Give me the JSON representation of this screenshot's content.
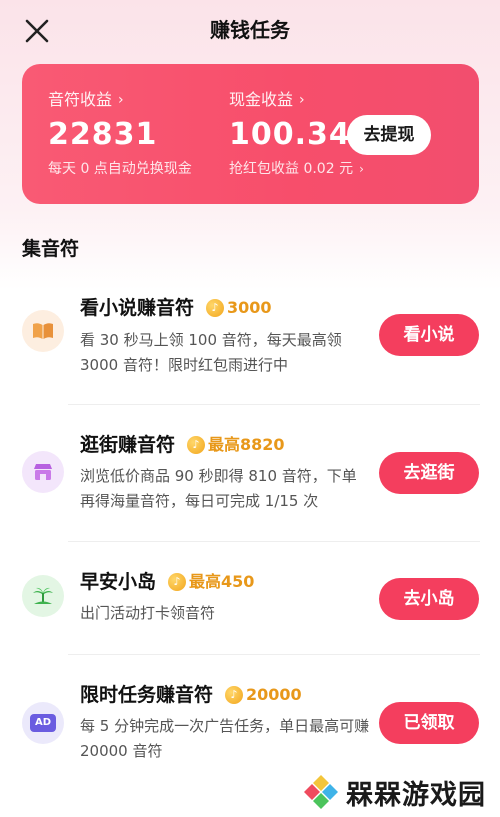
{
  "header": {
    "title": "赚钱任务",
    "close_icon": "close-icon"
  },
  "earnings": {
    "notes": {
      "label": "音符收益",
      "value": "22831",
      "sub": "每天 0 点自动兑换现金"
    },
    "cash": {
      "label": "现金收益",
      "value": "100.34",
      "sub": "抢红包收益 0.02 元"
    },
    "withdraw_label": "去提现",
    "chevron": "›",
    "card_color": "#f74e6b"
  },
  "section": {
    "title": "集音符"
  },
  "tasks": [
    {
      "icon": "book-icon",
      "name": "看小说赚音符",
      "reward": "3000",
      "desc": "看 30 秒马上领 100 音符，每天最高领 3000 音符！限时红包雨进行中",
      "button": "看小说"
    },
    {
      "icon": "shop-icon",
      "name": "逛街赚音符",
      "reward": "最高8820",
      "desc": "浏览低价商品 90 秒即得 810 音符，下单再得海量音符，每日可完成 1/15 次",
      "button": "去逛街"
    },
    {
      "icon": "island-icon",
      "name": "早安小岛",
      "reward": "最高450",
      "desc": "出门活动打卡领音符",
      "button": "去小岛"
    },
    {
      "icon": "ad-icon",
      "icon_text": "AD",
      "name": "限时任务赚音符",
      "reward": "20000",
      "desc": "每 5 分钟完成一次广告任务，单日最高可赚 20000 音符",
      "button": "已领取"
    }
  ],
  "coin_icon": "music-note-coin-icon",
  "coin_glyph": "♪",
  "watermark": {
    "text": "槑槑游戏园"
  },
  "colors": {
    "accent": "#f43e5e",
    "reward": "#e8981a"
  }
}
